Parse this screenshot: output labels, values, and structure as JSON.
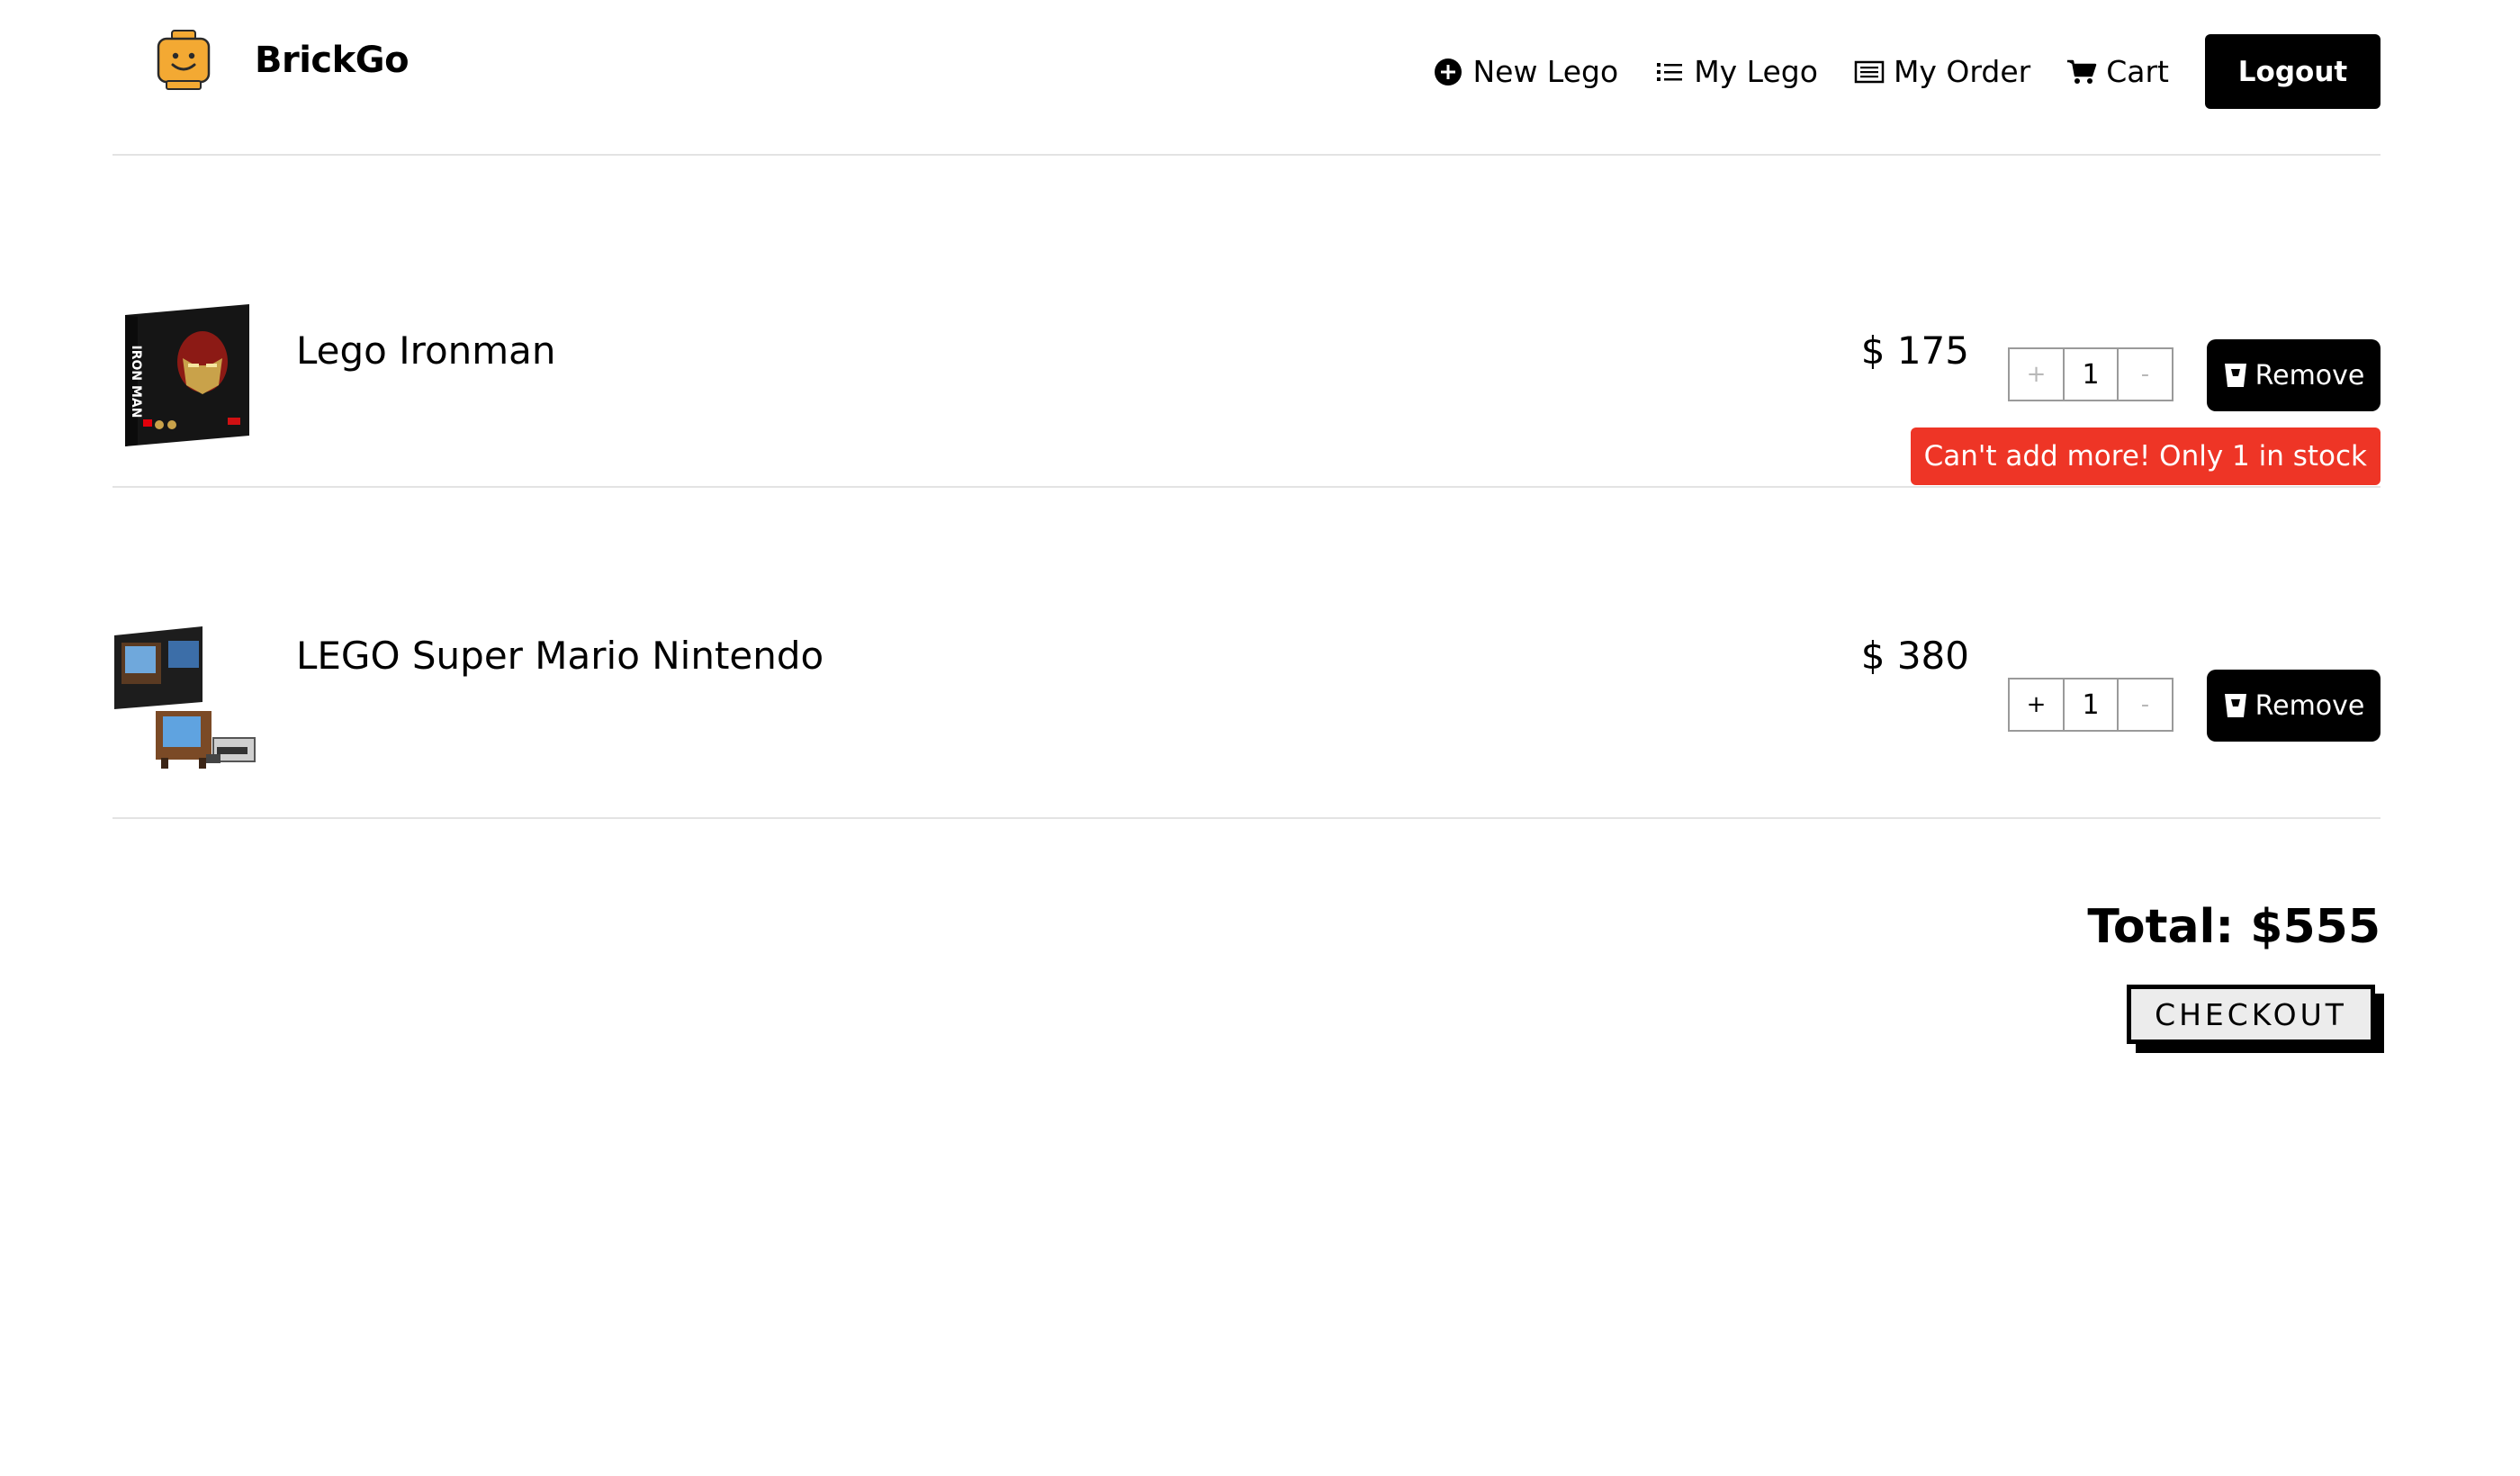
{
  "brand": {
    "name": "BrickGo",
    "logo_icon": "lego-head-icon",
    "logo_color": "#F3A933"
  },
  "nav": {
    "new_lego": "New Lego",
    "my_lego": "My Lego",
    "my_order": "My Order",
    "cart": "Cart",
    "logout": "Logout"
  },
  "cart": {
    "items": [
      {
        "name": "Lego Ironman",
        "price": "$ 175",
        "quantity": "1",
        "increment_label": "+",
        "decrement_label": "-",
        "remove_label": "Remove",
        "alert": "Can't add more! Only 1 in stock",
        "thumbnail": "iron-man-box-image"
      },
      {
        "name": "LEGO Super Mario Nintendo",
        "price": "$ 380",
        "quantity": "1",
        "increment_label": "+",
        "decrement_label": "-",
        "remove_label": "Remove",
        "thumbnail": "nintendo-set-image"
      }
    ],
    "total": "Total: $555",
    "checkout_label": "CHECKOUT"
  },
  "colors": {
    "accent": "#000000",
    "alert": "#EE3526",
    "divider": "#E3E3E3"
  }
}
